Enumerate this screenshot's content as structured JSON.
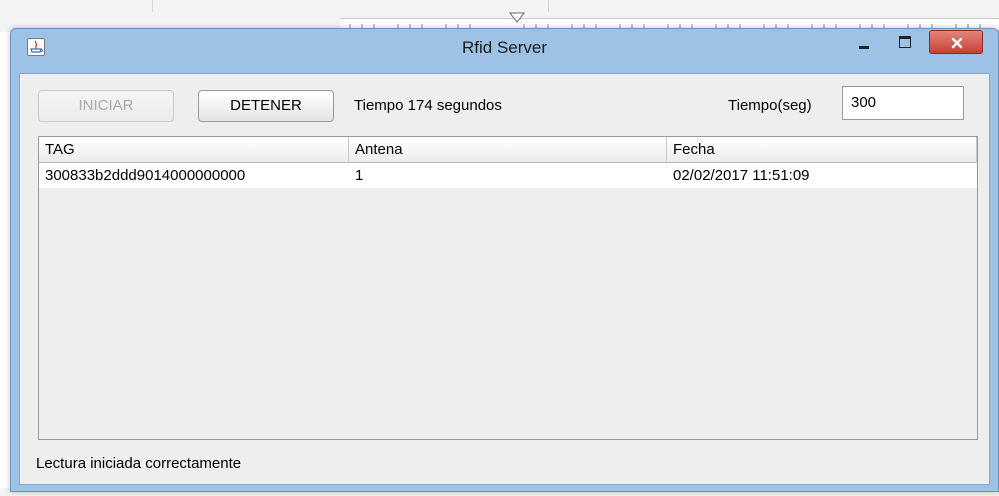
{
  "window": {
    "title": "Rfid Server"
  },
  "toolbar": {
    "start_label": "INICIAR",
    "stop_label": "DETENER",
    "elapsed_text": "Tiempo 174 segundos",
    "time_label": "Tiempo(seg)",
    "time_value": "300"
  },
  "table": {
    "columns": [
      "TAG",
      "Antena",
      "Fecha"
    ],
    "rows": [
      [
        "300833b2ddd9014000000000",
        "1",
        "02/02/2017 11:51:09"
      ]
    ]
  },
  "status": {
    "message": "Lectura iniciada correctamente"
  },
  "icons": {
    "app": "java-app-icon",
    "minimize": "minimize-icon",
    "maximize": "maximize-icon",
    "close": "close-icon"
  },
  "colors": {
    "frame": "#9ec1e6",
    "close_button": "#c74336",
    "client_bg": "#eeeeee"
  }
}
